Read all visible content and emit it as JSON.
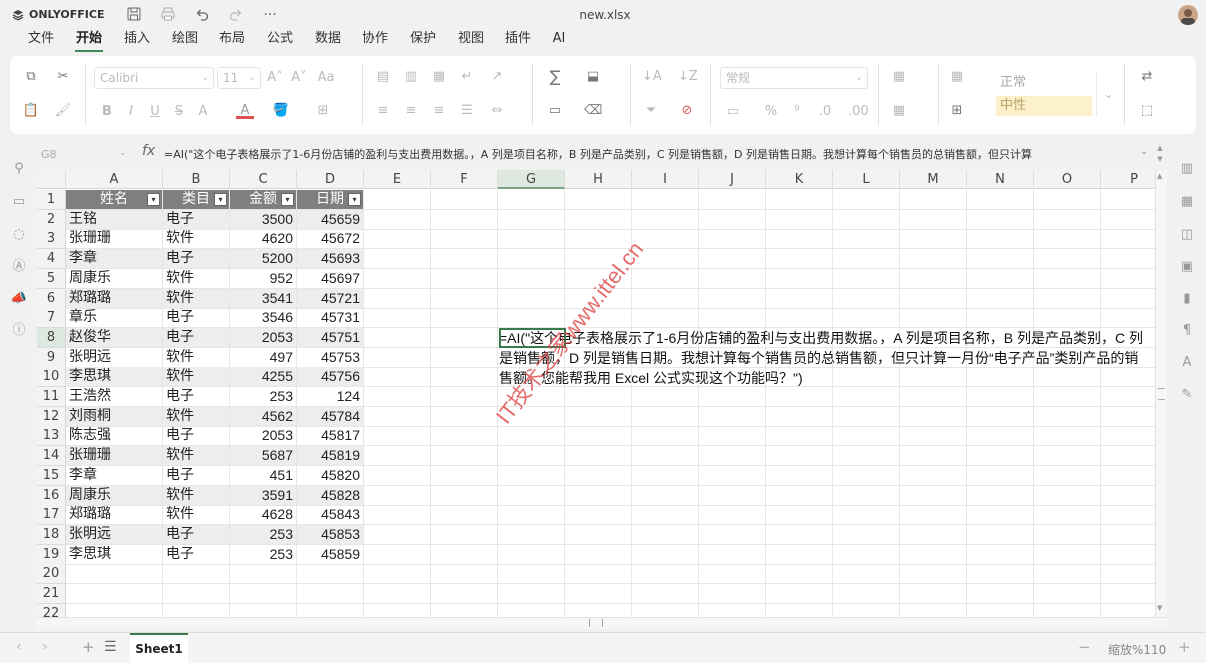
{
  "app": {
    "logo": "ONLYOFFICE",
    "file_name": "new.xlsx"
  },
  "quick_access": {
    "icons": [
      "save-icon",
      "print-icon",
      "undo-icon",
      "redo-icon",
      "more-icon"
    ],
    "more_label": "···"
  },
  "menu": {
    "items": [
      "文件",
      "开始",
      "插入",
      "绘图",
      "布局",
      "公式",
      "数据",
      "协作",
      "保护",
      "视图",
      "插件",
      "AI"
    ],
    "active": "开始"
  },
  "ribbon": {
    "font_name": "Calibri",
    "font_size": "11",
    "number_format": "常规",
    "styles": {
      "normal": "正常",
      "neutral": "中性"
    },
    "letters": {
      "bold": "B",
      "italic": "I",
      "underline": "U",
      "strike": "S",
      "font_color": "A",
      "increase": "A",
      "decrease": "A",
      "case": "Aa",
      "sub": "A"
    }
  },
  "formula_bar": {
    "cell_ref": "G8",
    "fx": "fx",
    "formula": "=AI(\"这个电子表格展示了1-6月份店铺的盈利与支出费用数据。，A 列是项目名称，B 列是产品类别，C 列是销售额，D 列是销售日期。我想计算每个销售员的总销售额，但只计算"
  },
  "sheet": {
    "columns": [
      "A",
      "B",
      "C",
      "D",
      "E",
      "F",
      "G",
      "H",
      "I",
      "J",
      "K",
      "L",
      "M",
      "N",
      "O",
      "P"
    ],
    "selected_column": "G",
    "selected_row": 8,
    "header": [
      "姓名",
      "类目",
      "金额",
      "日期"
    ],
    "rows": [
      [
        "王铭",
        "电子",
        "3500",
        "45659"
      ],
      [
        "张珊珊",
        "软件",
        "4620",
        "45672"
      ],
      [
        "李章",
        "电子",
        "5200",
        "45693"
      ],
      [
        "周康乐",
        "软件",
        "952",
        "45697"
      ],
      [
        "郑璐璐",
        "软件",
        "3541",
        "45721"
      ],
      [
        "章乐",
        "电子",
        "3546",
        "45731"
      ],
      [
        "赵俊华",
        "电子",
        "2053",
        "45751"
      ],
      [
        "张明远",
        "软件",
        "497",
        "45753"
      ],
      [
        " 李思琪",
        "软件",
        "4255",
        "45756"
      ],
      [
        "王浩然",
        "电子",
        "253",
        "124"
      ],
      [
        " 刘雨桐",
        "软件",
        "4562",
        "45784"
      ],
      [
        "陈志强",
        "电子",
        "2053",
        "45817"
      ],
      [
        "张珊珊",
        "软件",
        "5687",
        "45819"
      ],
      [
        "李章",
        "电子",
        "451",
        "45820"
      ],
      [
        "周康乐",
        "软件",
        "3591",
        "45828"
      ],
      [
        "郑璐璐",
        "软件",
        "4628",
        "45843"
      ],
      [
        "张明远",
        "电子",
        "253",
        "45853"
      ],
      [
        " 李思琪",
        "电子",
        "253",
        "45859"
      ]
    ],
    "row_numbers": [
      "1",
      "2",
      "3",
      "4",
      "5",
      "6",
      "7",
      "8",
      "9",
      "10",
      "11",
      "12",
      "13",
      "14",
      "15",
      "16",
      "17",
      "18",
      "19",
      "20",
      "21",
      "22"
    ],
    "ai_cell_text": "=AI(\"这个电子表格展示了1-6月份店铺的盈利与支出费用数据。，A 列是项目名称，B 列是产品类别，C 列是销售额，D 列是销售日期。我想计算每个销售员的总销售额，但只计算一月份“电子产品”类别产品的销售额。您能帮我用 Excel 公式实现这个功能吗？\")",
    "watermark": "IT技术之家www.ittel.cn"
  },
  "status": {
    "sheet_name": "Sheet1",
    "zoom": "缩放%110",
    "add": "+",
    "minus": "−"
  }
}
